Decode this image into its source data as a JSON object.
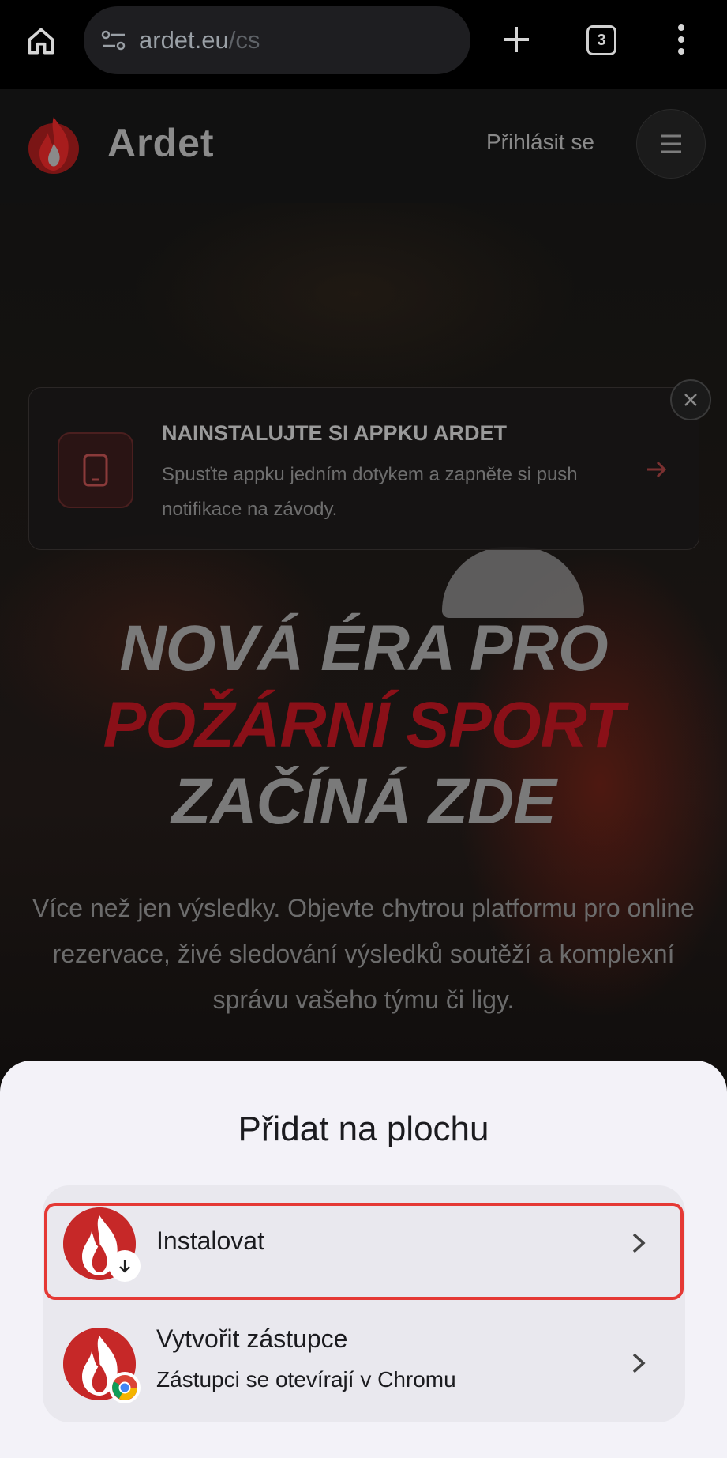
{
  "browser": {
    "url_host": "ardet.eu",
    "url_path": "/cs",
    "tab_count": "3",
    "icons": [
      "home-icon",
      "site-settings-icon",
      "new-tab-icon",
      "tab-switcher-icon",
      "more-vert-icon"
    ]
  },
  "site": {
    "brand": "Ardet",
    "login": "Přihlásit se",
    "brand_color": "#c62828"
  },
  "install_banner": {
    "title": "NAINSTALUJTE SI APPKU ARDET",
    "description": "Spusťte appku jedním dotykem a zapněte si push notifikace na závody."
  },
  "hero": {
    "line1": "NOVÁ ÉRA PRO",
    "line2": "POŽÁRNÍ SPORT",
    "line3": "ZAČÍNÁ ZDE",
    "description": "Více než jen výsledky. Objevte chytrou platformu pro online rezervace, živé sledování výsledků soutěží a komplexní správu vašeho týmu či ligy."
  },
  "sheet": {
    "title": "Přidat na plochu",
    "options": [
      {
        "label": "Instalovat",
        "icon": "app-install-icon",
        "highlighted": true
      },
      {
        "label": "Vytvořit zástupce",
        "sublabel": "Zástupci se otevírají v Chromu",
        "icon": "chrome-shortcut-icon"
      }
    ],
    "highlight_color": "#e53935"
  }
}
